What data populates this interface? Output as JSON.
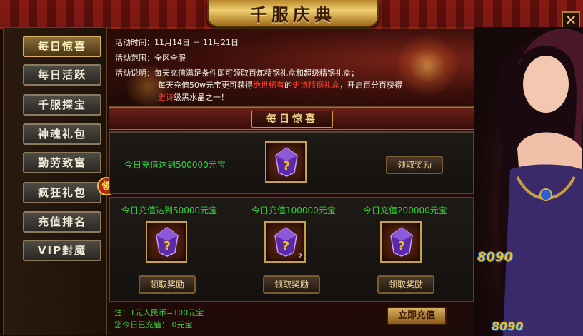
{
  "window": {
    "title": "千服庆典",
    "close_label": "✕"
  },
  "menu": {
    "items": [
      {
        "label": "每日惊喜",
        "active": true
      },
      {
        "label": "每日活跃",
        "active": false
      },
      {
        "label": "千服探宝",
        "active": false
      },
      {
        "label": "神魂礼包",
        "active": false
      },
      {
        "label": "勤劳致富",
        "active": false
      },
      {
        "label": "疯狂礼包",
        "active": false
      },
      {
        "label": "充值排名",
        "active": false
      },
      {
        "label": "VIP封魔",
        "active": false
      }
    ],
    "badge_label": "领"
  },
  "info": {
    "time_label": "活动时间：",
    "time_value": "11月14日 － 11月21日",
    "scope_label": "活动范围：",
    "scope_value": "全区全服",
    "desc_label": "活动说明：",
    "desc_line1": "每天充值满足条件即可领取百炼精钢礼盒和超级精钢礼盒；",
    "desc_line2_a": "每天充值50w元宝更可获得",
    "desc_line2_red1": "绝世稀有",
    "desc_line2_b": "的",
    "desc_line2_red2": "史诗精钢礼盒",
    "desc_line2_c": "，开启百分百获得",
    "desc_line3_red": "史诗",
    "desc_line3_b": "级黑水晶之一！"
  },
  "section": {
    "title": "每日惊喜"
  },
  "top_reward": {
    "condition": "今日充值达到500000元宝",
    "button_label": "领取奖励",
    "icon": "purple-gem-question-icon"
  },
  "rewards": [
    {
      "condition": "今日充值达到50000元宝",
      "button_label": "领取奖励",
      "count": "",
      "icon": "purple-gem-question-icon"
    },
    {
      "condition": "今日充值100000元宝",
      "button_label": "领取奖励",
      "count": "2",
      "icon": "purple-gem-question-icon"
    },
    {
      "condition": "今日充值200000元宝",
      "button_label": "领取奖励",
      "count": "",
      "icon": "purple-gem-question-icon"
    }
  ],
  "footer": {
    "note": "注：1元人民币=100元宝",
    "recharged": "您今日已充值：  0元宝",
    "recharge_button": "立即充值"
  },
  "branding": {
    "logo_top": "8090",
    "logo_bottom": "8090"
  },
  "colors": {
    "condition_text": "#32d23c",
    "highlight_red": "#ff3a2a",
    "gold": "#d8b060"
  }
}
